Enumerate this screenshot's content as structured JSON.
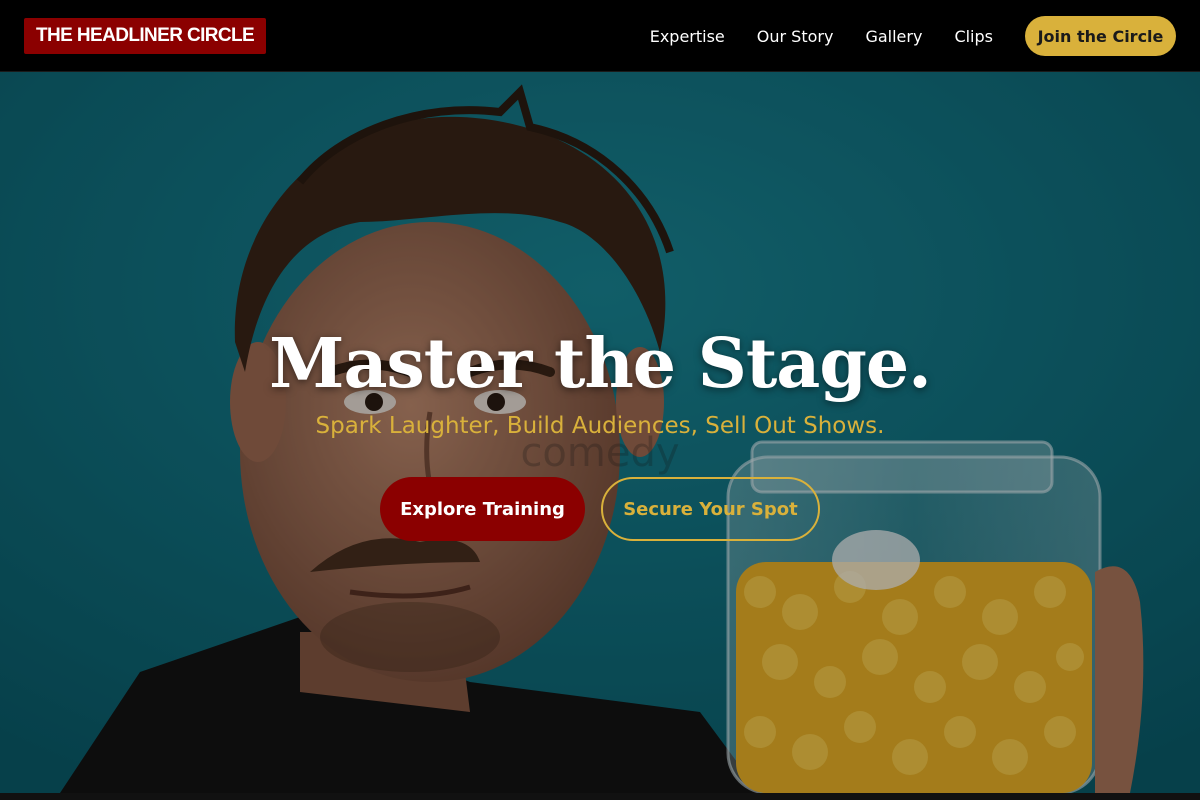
{
  "nav": {
    "logo": "THE HEADLINER CIRCLE",
    "links": [
      "Expertise",
      "Our Story",
      "Gallery",
      "Clips"
    ],
    "cta": "Join the Circle"
  },
  "hero": {
    "title": "Master the Stage.",
    "subtitle": "Spark Laughter, Build Audiences, Sell Out Shows.",
    "watermark": "comedy",
    "primary_button": "Explore Training",
    "secondary_button": "Secure Your Spot"
  },
  "colors": {
    "brand_red": "#8b0000",
    "gold": "#d9b13b",
    "teal_background": "#0c6f80",
    "nav_background": "#000000"
  }
}
